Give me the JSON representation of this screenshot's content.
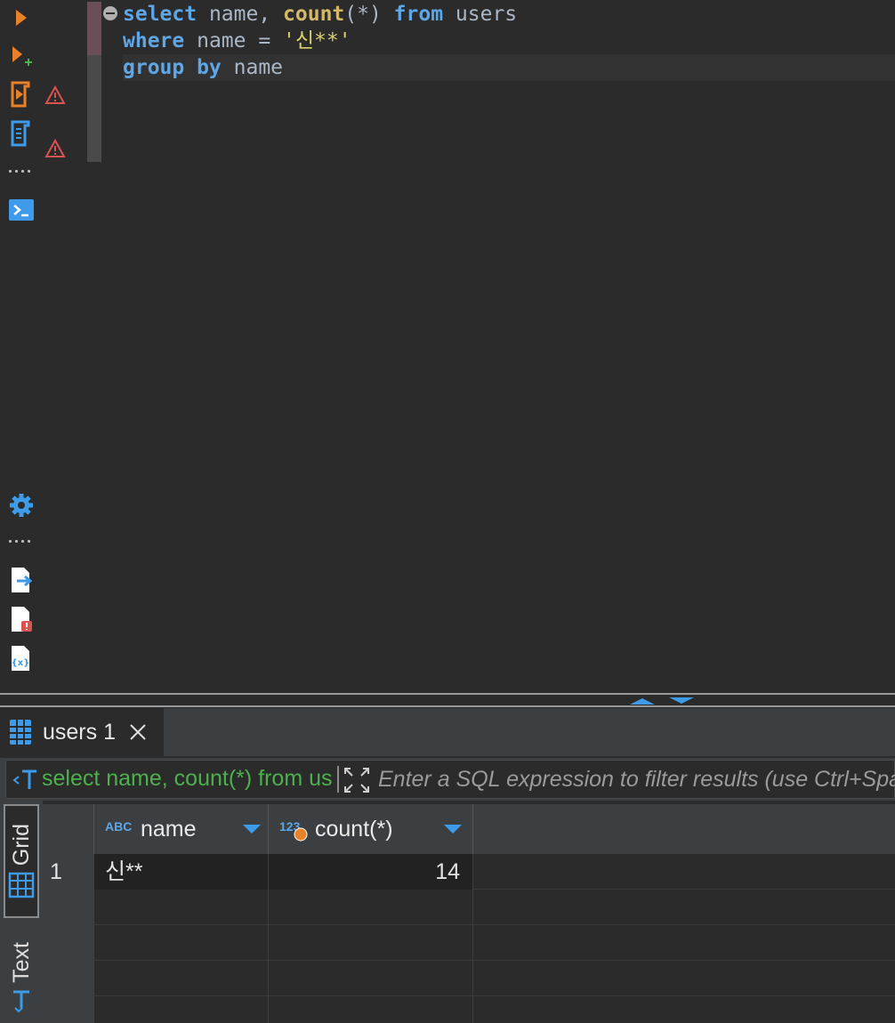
{
  "editor": {
    "lines": [
      [
        {
          "t": "select",
          "c": "kw"
        },
        {
          "t": " name, ",
          "c": ""
        },
        {
          "t": "count",
          "c": "fn"
        },
        {
          "t": "(*) ",
          "c": ""
        },
        {
          "t": "from",
          "c": "kw"
        },
        {
          "t": " users",
          "c": ""
        }
      ],
      [
        {
          "t": "where",
          "c": "kw"
        },
        {
          "t": " name = ",
          "c": ""
        },
        {
          "t": "'신**'",
          "c": "str"
        }
      ],
      [
        {
          "t": "group by",
          "c": "kw"
        },
        {
          "t": " name",
          "c": ""
        }
      ]
    ]
  },
  "results": {
    "tab_label": "users 1",
    "filter_query_text": "select name, count(*) from users",
    "filter_placeholder": "Enter a SQL expression to filter results (use Ctrl+Space)",
    "side_tabs": [
      "Grid",
      "Text"
    ],
    "columns": [
      {
        "type_label": "ABC",
        "name": "name"
      },
      {
        "type_label": "123",
        "name": "count(*)"
      }
    ],
    "rows": [
      {
        "num": "1",
        "name": "신**",
        "count": "14"
      }
    ]
  },
  "colors": {
    "keyword": "#5ea6e6",
    "function": "#d4b86a",
    "string": "#d9d26b",
    "accent_orange": "#e8822a",
    "accent_blue": "#3d9be9",
    "warning_red": "#d9534f"
  },
  "icons": {
    "toolbar_top": [
      "execute-statement-icon",
      "execute-in-new-tab-icon",
      "execute-script-icon",
      "execute-script-new-tab-icon",
      "open-console-icon"
    ],
    "toolbar_bottom": [
      "settings-gear-icon",
      "export-icon",
      "script-error-icon",
      "variables-icon"
    ]
  }
}
